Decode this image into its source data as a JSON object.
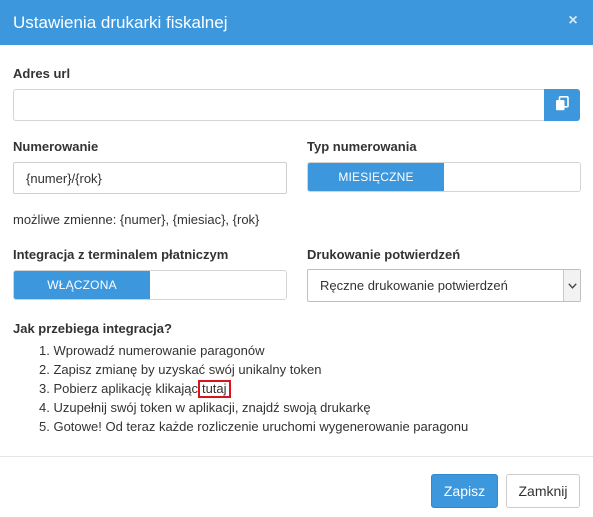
{
  "dialog": {
    "title": "Ustawienia drukarki fiskalnej",
    "close_icon": "×"
  },
  "url": {
    "label": "Adres url",
    "value": "",
    "copy_icon": "copy-icon"
  },
  "numbering": {
    "label": "Numerowanie",
    "value": "{numer}/{rok}",
    "hint": "możliwe zmienne: {numer}, {miesiac}, {rok}"
  },
  "numbering_type": {
    "label": "Typ numerowania",
    "active_option": "MIESIĘCZNE",
    "inactive_option": ""
  },
  "terminal": {
    "label": "Integracja z terminalem płatniczym",
    "active_option": "WŁĄCZONA",
    "inactive_option": ""
  },
  "printing": {
    "label": "Drukowanie potwierdzeń",
    "selected": "Ręczne drukowanie potwierdzeń"
  },
  "integration": {
    "heading": "Jak przebiega integracja?",
    "steps": [
      "1. Wprowadź numerowanie paragonów",
      "2. Zapisz zmianę by uzyskać swój unikalny token",
      "3. Pobierz aplikację klikając",
      "4. Uzupełnij swój token w aplikacji, znajdź swoją drukarkę",
      "5. Gotowe! Od teraz każde rozliczenie uruchomi wygenerowanie paragonu"
    ],
    "link_text": "tutaj"
  },
  "footer": {
    "save_label": "Zapisz",
    "close_label": "Zamknij"
  },
  "colors": {
    "primary": "#3c97dd",
    "highlight_border": "#d9141b"
  }
}
